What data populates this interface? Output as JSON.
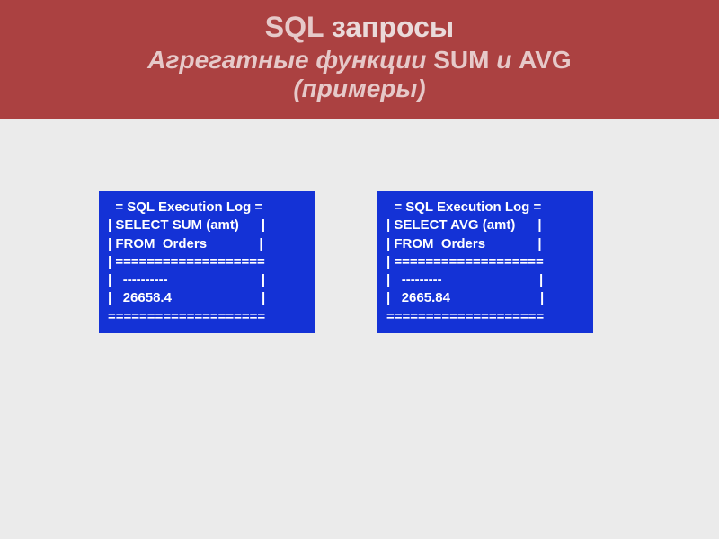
{
  "header": {
    "line1_a": "SQL",
    "line1_b": " запросы",
    "line2_a": "Агрегатные функции ",
    "line2_sum": "SUM",
    "line2_mid": " и ",
    "line2_avg": "AVG",
    "line3": "(примеры)"
  },
  "boxes": {
    "left": {
      "l1": "  = SQL Execution Log =",
      "l2": "| SELECT SUM (amt)      |",
      "l3": "| FROM  Orders              |",
      "l4": "| ===================",
      "l5": "|   ----------                         |",
      "l6": "|   26658.4                        |",
      "l7": "===================="
    },
    "right": {
      "l1": "  = SQL Execution Log =",
      "l2": "| SELECT AVG (amt)      |",
      "l3": "| FROM  Orders              |",
      "l4": "| ===================",
      "l5": "|   ---------                          |",
      "l6": "|   2665.84                        |",
      "l7": "===================="
    }
  }
}
